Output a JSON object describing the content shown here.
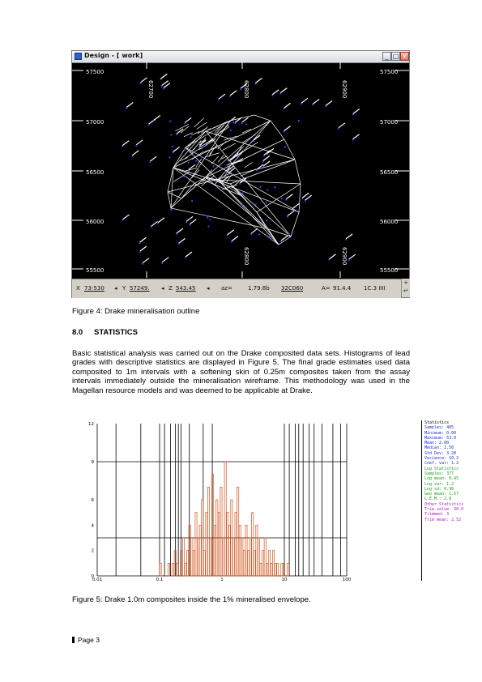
{
  "window": {
    "title": "Design - [ work]",
    "minimize_label": "_",
    "maximize_label": "□",
    "close_label": "x",
    "easting_labels": [
      "62700",
      "62800",
      "62900",
      "63000"
    ],
    "northing_labels": [
      "57500",
      "57000",
      "56500",
      "56000",
      "55500"
    ],
    "status": {
      "x_label": "X",
      "x_value": "73-530",
      "y_label": "Y",
      "y_value": "57249.",
      "z_label": "Z",
      "z_value": "543.45",
      "aux1": "az=",
      "aux2": "1.79.8b",
      "scale_value": "32C060",
      "angle_label": "A=",
      "angle_value": "91.4.4",
      "zoom_value": "1C.3 IIII"
    },
    "colors": {
      "background": "#000000",
      "wireframe": "#ffffff",
      "points": "#3a46ff",
      "labels": "#ffffff"
    }
  },
  "figure4_caption": "Figure 4:  Drake mineralisation outline",
  "section": {
    "number": "8.0",
    "title": "STATISTICS"
  },
  "paragraph": "Basic statistical analysis was carried out on the Drake composited data sets. Histograms of lead grades with descriptive statistics are displayed in Figure 5.  The final grade estimates used data composited to 1m intervals with a softening skin of 0.25m composites taken from the assay intervals immediately outside the mineralisation wireframe.  This methodology was used in the Magellan resource models and was deemed to be applicable at Drake.",
  "chart_data": {
    "type": "bar",
    "x_scale": "log",
    "xlim": [
      0.01,
      100
    ],
    "ylim": [
      0,
      12
    ],
    "x_tick_labels": [
      "0.01",
      "0.1",
      "1",
      "10",
      "100"
    ],
    "y_tick_labels": [
      "12",
      "9",
      "6",
      "4",
      "2",
      "0"
    ],
    "bar_color": "#d2541e",
    "values": [
      1,
      0,
      0,
      0,
      1,
      0,
      1,
      2,
      1,
      0,
      2,
      3,
      1,
      2,
      4,
      3,
      2,
      5,
      3,
      4,
      6,
      2,
      5,
      7,
      3,
      8,
      4,
      6,
      5,
      7,
      3,
      9,
      5,
      4,
      6,
      3,
      5,
      7,
      4,
      3,
      2,
      4,
      2,
      3,
      5,
      2,
      4,
      3,
      1,
      2,
      3,
      1,
      2,
      1,
      2,
      1,
      1,
      0,
      1,
      1,
      0,
      1
    ],
    "stats_text": [
      {
        "text": "Statistics",
        "color": "#000000"
      },
      {
        "text": "Samples: 405",
        "color": "#1a2fd0"
      },
      {
        "text": "Minimum: 0.00",
        "color": "#1a2fd0"
      },
      {
        "text": "Maximum: 53.0",
        "color": "#1a2fd0"
      },
      {
        "text": "Mean: 2.60",
        "color": "#1a2fd0"
      },
      {
        "text": "Median: 1.50",
        "color": "#1a2fd0"
      },
      {
        "text": "Std Dev: 3.20",
        "color": "#1a2fd0"
      },
      {
        "text": "Variance: 10.2",
        "color": "#1a2fd0"
      },
      {
        "text": "Coef. var: 1.2",
        "color": "#1a2fd0"
      },
      {
        "text": "Log Statistics",
        "color": "#1f9a1f"
      },
      {
        "text": "Samples: 377",
        "color": "#1f9a1f"
      },
      {
        "text": "Log mean: 0.45",
        "color": "#1f9a1f"
      },
      {
        "text": "Log var: 1.2",
        "color": "#1f9a1f"
      },
      {
        "text": "Log sd: 0.98",
        "color": "#1f9a1f"
      },
      {
        "text": "Geo mean: 1.57",
        "color": "#1f9a1f"
      },
      {
        "text": "L.E.M.: 2.8",
        "color": "#1f9a1f"
      },
      {
        "text": "Other Statistics",
        "color": "#b020b0"
      },
      {
        "text": "Trim value: 30.0",
        "color": "#b020b0"
      },
      {
        "text": "Trimmed: 3",
        "color": "#b020b0"
      },
      {
        "text": "Trim mean: 2.52",
        "color": "#b020b0"
      }
    ]
  },
  "figure5_caption": "Figure 5:  Drake 1.0m composites inside the 1% mineralised envelope.",
  "footer": {
    "page_label": "Page 3"
  }
}
